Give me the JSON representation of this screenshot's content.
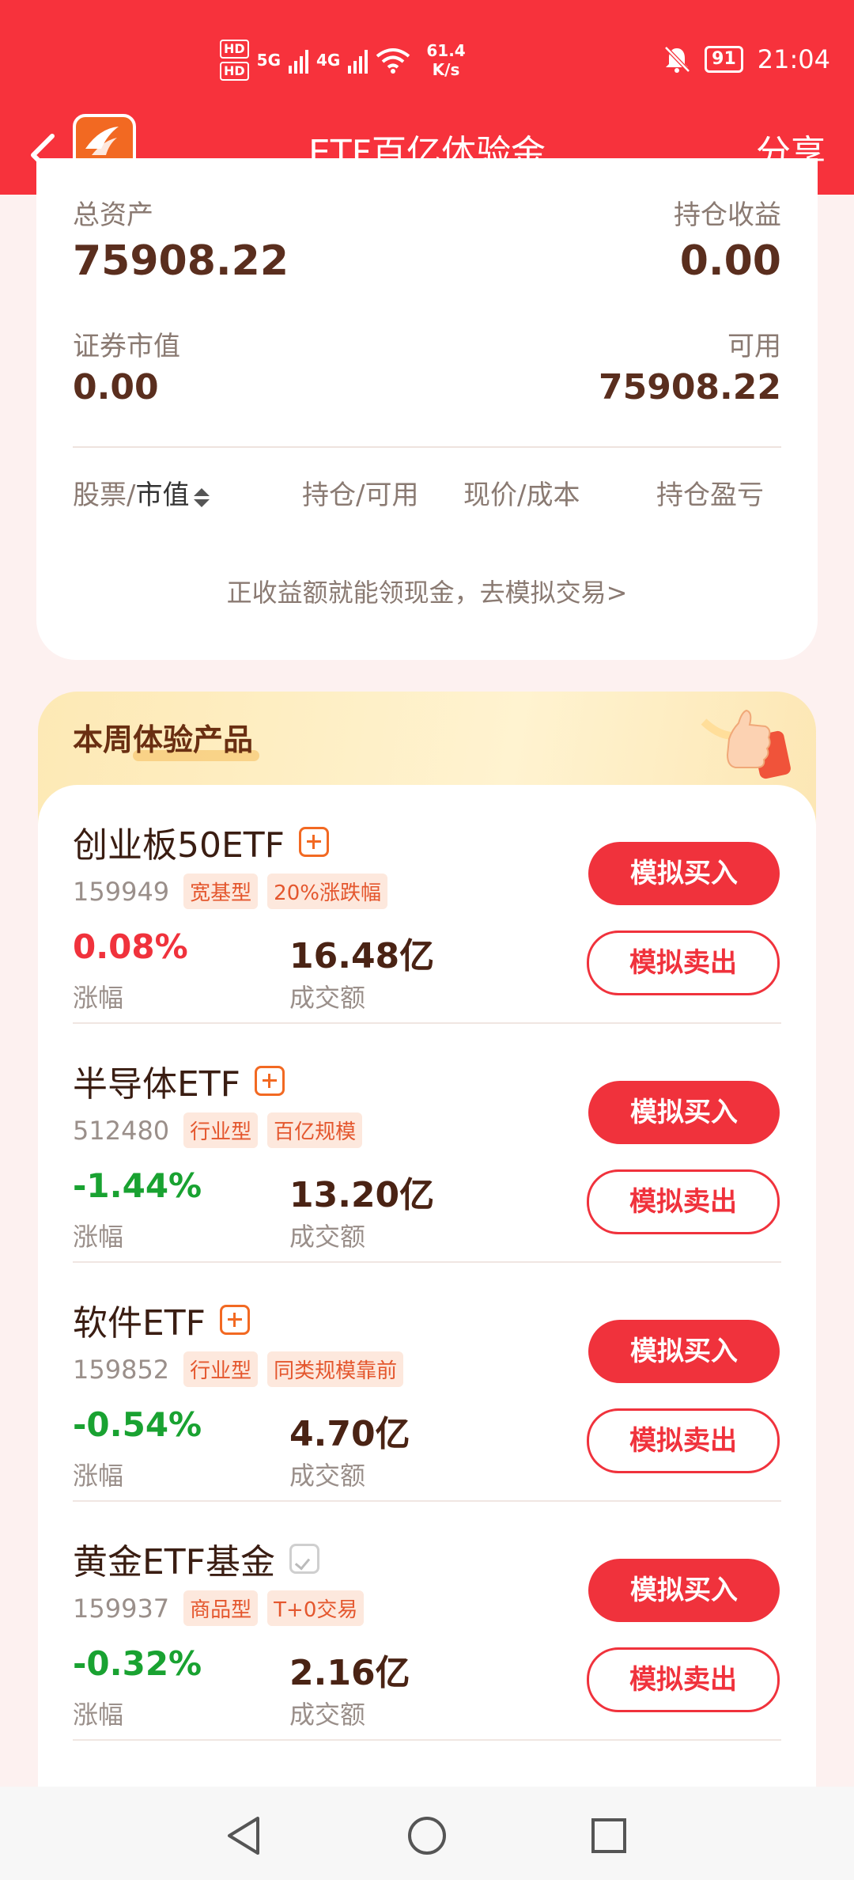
{
  "status_bar": {
    "hd1": "HD",
    "hd2": "HD",
    "net1": "5G",
    "net2": "4G",
    "speed_value": "61.4",
    "speed_unit": "K/s",
    "battery": "91",
    "time": "21:04"
  },
  "nav": {
    "title": "ETF百亿体验金",
    "share": "分享"
  },
  "assets": {
    "total_label": "总资产",
    "total_value": "75908.22",
    "profit_label": "持仓收益",
    "profit_value": "0.00",
    "market_label": "证券市值",
    "market_value": "0.00",
    "available_label": "可用",
    "available_value": "75908.22",
    "columns": [
      "股票/",
      "市值",
      "持仓/可用",
      "现价/成本",
      "持仓盈亏"
    ],
    "hint": "正收益额就能领现金，去模拟交易>"
  },
  "weekly": {
    "title": "本周体验产品",
    "change_label": "涨幅",
    "volume_label": "成交额",
    "buy_label": "模拟买入",
    "sell_label": "模拟卖出",
    "items": [
      {
        "name": "创业板50ETF",
        "code": "159949",
        "tags": [
          "宽基型",
          "20%涨跌幅"
        ],
        "change": "0.08%",
        "volume": "16.48亿",
        "trend": "up",
        "favorited": false
      },
      {
        "name": "半导体ETF",
        "code": "512480",
        "tags": [
          "行业型",
          "百亿规模"
        ],
        "change": "-1.44%",
        "volume": "13.20亿",
        "trend": "down",
        "favorited": false
      },
      {
        "name": "软件ETF",
        "code": "159852",
        "tags": [
          "行业型",
          "同类规模靠前"
        ],
        "change": "-0.54%",
        "volume": "4.70亿",
        "trend": "down",
        "favorited": false
      },
      {
        "name": "黄金ETF基金",
        "code": "159937",
        "tags": [
          "商品型",
          "T+0交易"
        ],
        "change": "-0.32%",
        "volume": "2.16亿",
        "trend": "down",
        "favorited": true
      }
    ]
  },
  "colors": {
    "brand_red": "#f7323c",
    "up": "#f0323c",
    "down": "#19a231"
  }
}
